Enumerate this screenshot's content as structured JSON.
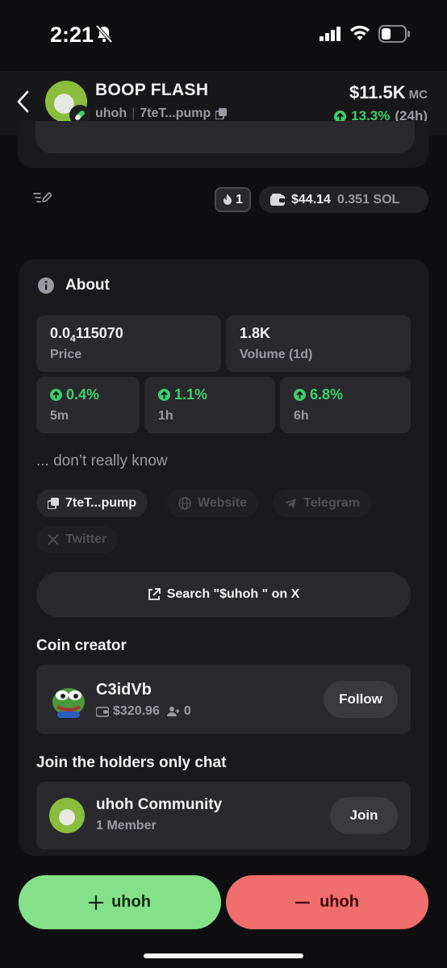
{
  "status_bar": {
    "time": "2:21"
  },
  "header": {
    "token_name": "BOOP FLASH",
    "ticker": "uhoh",
    "address": "7teT...pump",
    "market_cap": "$11.5K",
    "market_cap_unit": "MC",
    "change_pct": "13.3%",
    "change_period": "(24h)"
  },
  "toolbar": {
    "fire_count": "1",
    "wallet_usd": "$44.14",
    "wallet_sol": "0.351 SOL"
  },
  "about": {
    "title": "About",
    "price_value_prefix": "0.0",
    "price_value_subscript": "4",
    "price_value_suffix": "115070",
    "price_label": "Price",
    "volume_value": "1.8K",
    "volume_label": "Volume (1d)",
    "changes": [
      {
        "value": "0.4%",
        "label": "5m"
      },
      {
        "value": "1.1%",
        "label": "1h"
      },
      {
        "value": "6.8%",
        "label": "6h"
      }
    ],
    "description": "... don’t really know",
    "links": {
      "address": "7teT...pump",
      "website": "Website",
      "telegram": "Telegram",
      "twitter": "Twitter"
    },
    "search_x_label": "Search \"$uhoh \" on X"
  },
  "creator": {
    "section_title": "Coin creator",
    "name": "C3idVb",
    "balance": "$320.96",
    "followers": "0",
    "follow_label": "Follow"
  },
  "community": {
    "section_title": "Join the holders only chat",
    "name": "uhoh  Community",
    "members": "1 Member",
    "join_label": "Join"
  },
  "actions": {
    "buy_label": "uhoh",
    "sell_label": "uhoh"
  },
  "colors": {
    "accent_green": "#3ecf6c",
    "buy_bg": "#85e08a",
    "sell_bg": "#f06e6e",
    "background": "#0f0f11"
  }
}
